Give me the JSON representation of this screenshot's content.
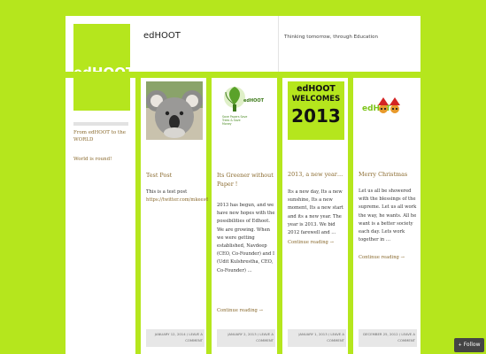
{
  "header": {
    "logo_text": "edHOOT",
    "site_title": "edHOOT",
    "tagline": "Thinking tomorrow, through Education"
  },
  "sidebar": {
    "links": [
      "From edHOOT to the WORLD",
      "World is round!"
    ]
  },
  "posts": [
    {
      "title": "Test Post",
      "body": "This is a test post",
      "link": "https://twitter.com/mkees65/",
      "more": "",
      "date": "JANUARY 12, 2014",
      "comment_label": "LEAVE A COMMENT",
      "image": "koala-photo"
    },
    {
      "title": "Its Greener without Paper !",
      "body": "2013 has begun, and we have new hopes with the possibilities of Edhoot. We are growing. When we were getting established, Navdeep (CEO, Co-Founder) and I (Udit Kulshrestha, CEO, Co-Founder) …",
      "link": "",
      "more": "Continue reading →",
      "date": "JANUARY 2, 2013",
      "comment_label": "LEAVE A COMMENT",
      "image": "green-plant-logo",
      "image_caption": "edHOOT",
      "image_subcaption": "Save Papers Save Trees & Save Money"
    },
    {
      "title": "2013, a new year…",
      "body": "Its a new day, Its a new sunshine, Its a new moment, Its a new start and its a new year. The year is 2013. We bid 2012 farewell and …",
      "link": "",
      "more": "Continue reading →",
      "date": "JANUARY 1, 2013",
      "comment_label": "LEAVE A COMMENT",
      "image": "welcome-2013-banner",
      "banner_line1": "edHOOT",
      "banner_line2": "WELCOMES",
      "banner_line3": "2013"
    },
    {
      "title": "Merry Christmas",
      "body": "Let us all be showered with the blessings of the supreme. Let us all work the way, he wants. All he want is a better society each day. Lets work together in …",
      "link": "",
      "more": "Continue reading →",
      "date": "DECEMBER 25, 2012",
      "comment_label": "LEAVE A COMMENT",
      "image": "christmas-owls-logo",
      "image_text": "edH  T"
    }
  ],
  "follow": {
    "label": "Follow",
    "icon": "plus-icon"
  },
  "colors": {
    "background": "#b5e61d",
    "link": "#8a6a2e"
  }
}
